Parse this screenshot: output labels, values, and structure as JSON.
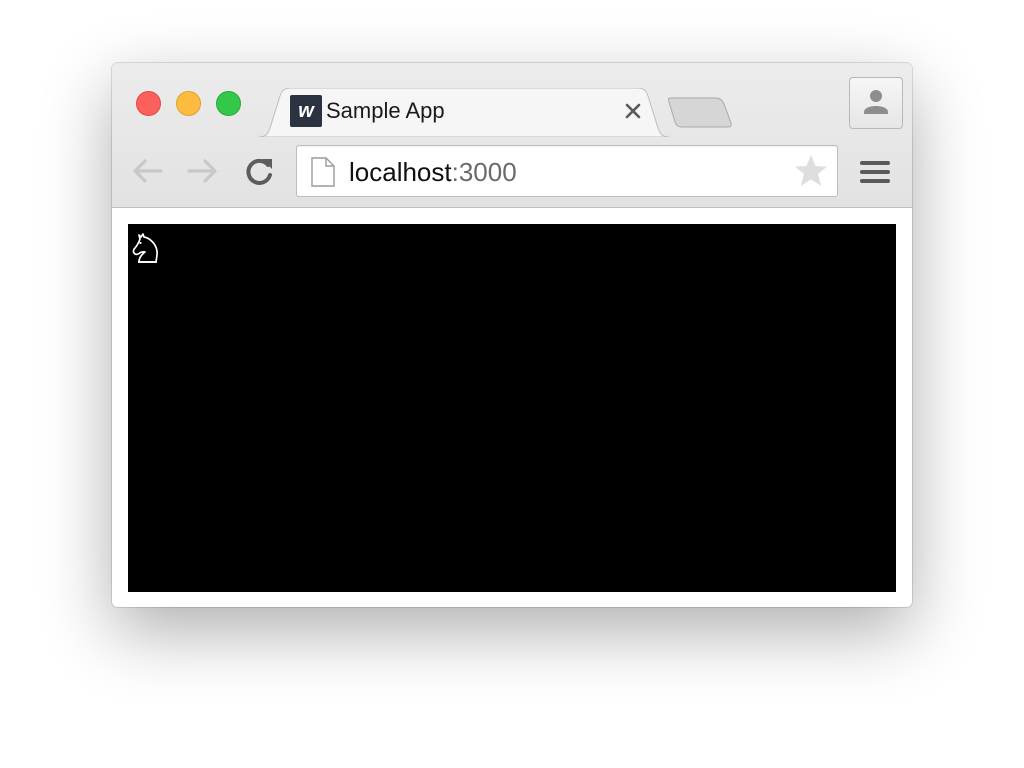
{
  "browser": {
    "tab": {
      "favicon_letter": "w",
      "title": "Sample App"
    },
    "address": {
      "host": "localhost",
      "port": ":3000"
    }
  },
  "icons": {
    "back": "arrow-left-icon",
    "forward": "arrow-right-icon",
    "reload": "reload-icon",
    "page": "page-icon",
    "bookmark": "star-icon",
    "menu": "hamburger-menu-icon",
    "profile": "person-icon",
    "tab_close": "close-icon",
    "content": "chess-knight-icon"
  },
  "colors": {
    "close_light": "#fc605c",
    "minimize_light": "#fdbc40",
    "zoom_light": "#34c84a",
    "favicon_bg": "#2c3340",
    "content_bg": "#000000"
  }
}
